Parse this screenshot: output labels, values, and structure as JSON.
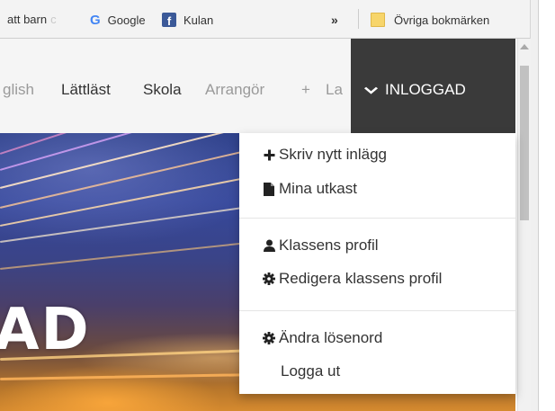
{
  "bookmarks": {
    "items": [
      {
        "label": "att barn",
        "faded": "c",
        "icon": "bookmark-page-icon"
      },
      {
        "label": "Google",
        "icon": "google-icon"
      },
      {
        "label": "Kulan",
        "icon": "facebook-icon"
      }
    ],
    "overflow": "»",
    "other_label": "Övriga bokmärken",
    "google_glyph": "G",
    "facebook_glyph": "f"
  },
  "nav": {
    "links": [
      "glish",
      "Lättläst",
      "Skola",
      "Arrangör",
      "+",
      "La"
    ],
    "login_label": "INLOGGAD",
    "login_icon": "chevron-down-icon"
  },
  "hero": {
    "text": "AD"
  },
  "dropdown": {
    "items": [
      {
        "label": "Skriv nytt inlägg",
        "icon": "plus-icon",
        "glyph": "✚"
      },
      {
        "label": "Mina utkast",
        "icon": "file-icon",
        "glyph": ""
      },
      {
        "label": "Klassens profil",
        "icon": "user-icon",
        "glyph": ""
      },
      {
        "label": "Redigera klassens profil",
        "icon": "cog-icon",
        "glyph": "✱"
      },
      {
        "label": "Ändra lösenord",
        "icon": "cog-icon",
        "glyph": "✱"
      },
      {
        "label": "Logga ut",
        "icon": "",
        "glyph": ""
      }
    ]
  },
  "colors": {
    "login_bg": "#3a3a3a",
    "nav_bg": "#f5f5f5",
    "facebook": "#3b5998",
    "folder": "#f7d56b"
  }
}
